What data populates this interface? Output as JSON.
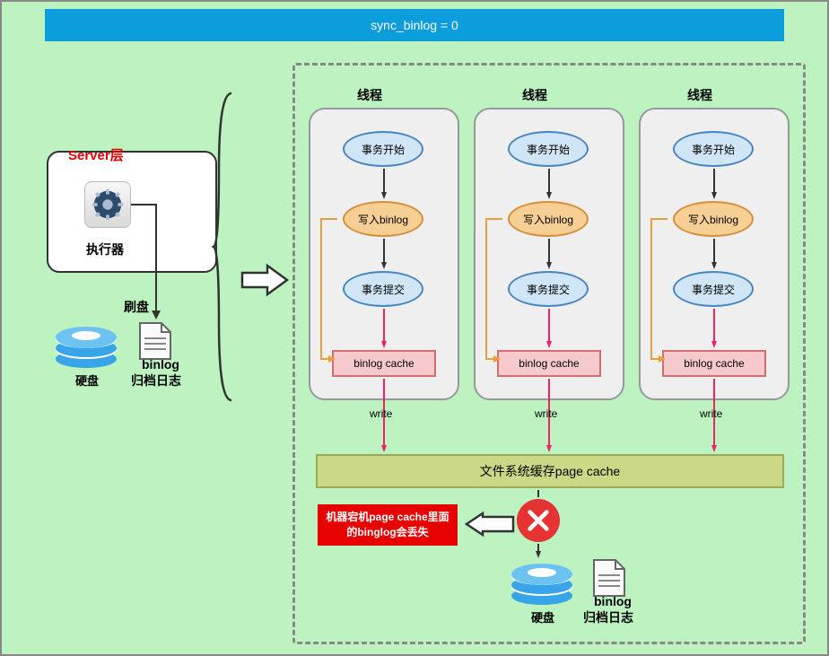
{
  "title": "sync_binlog = 0",
  "server": {
    "layer_label": "Server层",
    "executor": "执行器",
    "flush_label": "刷盘"
  },
  "disk_label": "硬盘",
  "binlog": {
    "name": "binlog",
    "desc": "归档日志"
  },
  "thread_label": "线程",
  "steps": {
    "tx_begin": "事务开始",
    "write_binlog": "写入binlog",
    "tx_commit": "事务提交",
    "binlog_cache": "binlog cache"
  },
  "write_label": "write",
  "page_cache": "文件系统缓存page cache",
  "warning": "机器宕机page cache里面的binglog会丢失"
}
